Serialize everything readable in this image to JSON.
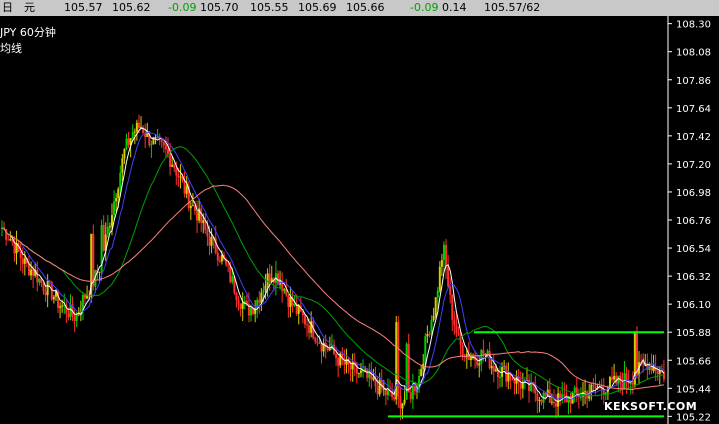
{
  "quote_bar": {
    "label_day": "日",
    "label_yuan": "元",
    "open": "105.57",
    "high": "105.62",
    "change": "-0.09",
    "v1": "105.70",
    "v2": "105.55",
    "v3": "105.69",
    "v4": "105.66",
    "change2": "-0.09",
    "pct": "0.14",
    "bid_ask": "105.57/62"
  },
  "chart_header": {
    "symbol_interval": "JPY   60分钟",
    "indicator": "均线"
  },
  "colors": {
    "background": "#000000",
    "axis": "#ffffff",
    "candle_up": "#d0d000",
    "candle_down": "#ff3030",
    "candle_mid": "#00d000",
    "ma_short": "#ffffff",
    "ma_mid": "#4040ff",
    "ma_long": "#00a000",
    "ma_longest": "#ff8080",
    "range_box": "#00ff00"
  },
  "watermark": "KEKSOFT.COM",
  "chart_data": {
    "type": "line",
    "title": "JPY 60分钟",
    "ylim": [
      105.16,
      108.36
    ],
    "y_ticks": [
      "108.30",
      "108.08",
      "107.86",
      "107.64",
      "107.42",
      "107.20",
      "106.98",
      "106.76",
      "106.54",
      "106.32",
      "106.10",
      "105.88",
      "105.66",
      "105.44",
      "105.22"
    ],
    "y_tick_values": [
      108.3,
      108.08,
      107.86,
      107.64,
      107.42,
      107.2,
      106.98,
      106.76,
      106.54,
      106.32,
      106.1,
      105.88,
      105.66,
      105.44,
      105.22
    ],
    "price": [
      106.7,
      106.62,
      106.5,
      106.4,
      106.35,
      106.25,
      106.2,
      106.1,
      106.05,
      106.0,
      106.15,
      106.25,
      106.4,
      106.7,
      107.0,
      107.3,
      107.45,
      107.5,
      107.4,
      107.35,
      107.3,
      107.2,
      107.05,
      106.9,
      106.8,
      106.65,
      106.55,
      106.45,
      106.3,
      106.15,
      106.05,
      106.1,
      106.25,
      106.35,
      106.3,
      106.15,
      106.05,
      105.98,
      105.9,
      105.8,
      105.75,
      105.68,
      105.62,
      105.58,
      105.55,
      105.5,
      105.45,
      105.4,
      105.36,
      105.34,
      105.4,
      105.52,
      105.85,
      106.1,
      106.55,
      106.05,
      105.78,
      105.7,
      105.68,
      105.72,
      105.62,
      105.58,
      105.55,
      105.5,
      105.45,
      105.42,
      105.38,
      105.36,
      105.34,
      105.36,
      105.38,
      105.4,
      105.42,
      105.44,
      105.46,
      105.48,
      105.5,
      105.52,
      105.58,
      105.65,
      105.6,
      105.55
    ],
    "range_box": {
      "top": 105.88,
      "bottom": 105.22
    }
  }
}
